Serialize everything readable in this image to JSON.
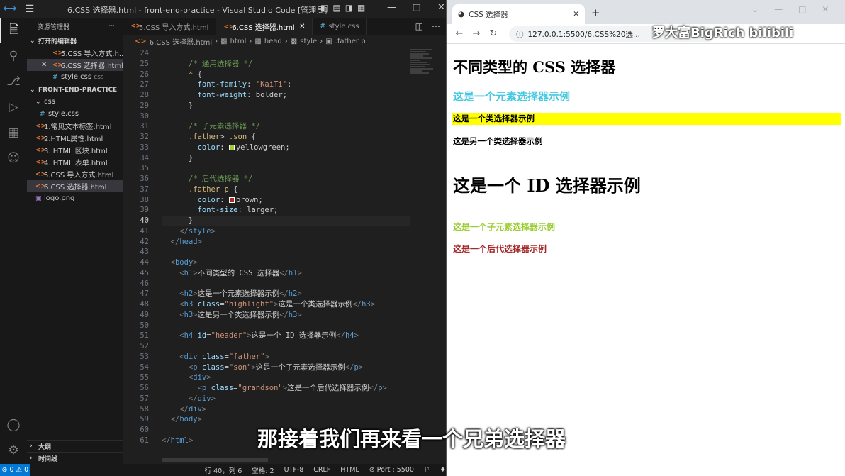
{
  "vscode": {
    "title": "6.CSS 选择器.html - front-end-practice - Visual Studio Code [管理员]",
    "logo": "VS Code logo",
    "window_controls": [
      "—",
      "□",
      "✕"
    ],
    "sidebar": {
      "header": "资源管理器",
      "header_more": "···",
      "open_editors_label": "打开的编辑器",
      "open_editors": [
        {
          "label": "5.CSS 导入方式.h...",
          "type": "html"
        },
        {
          "label": "6.CSS 选择器.html",
          "type": "html",
          "selected": true,
          "close": "✕"
        },
        {
          "label": "style.css",
          "type": "css",
          "suffix": "css"
        }
      ],
      "project_label": "FRONT-END-PRACTICE",
      "folder": "css",
      "folder_files": [
        {
          "label": "style.css",
          "type": "css"
        }
      ],
      "files": [
        {
          "label": "1.常见文本标签.html",
          "type": "html"
        },
        {
          "label": "2.HTML属性.html",
          "type": "html"
        },
        {
          "label": "3. HTML 区块.html",
          "type": "html"
        },
        {
          "label": "4. HTML 表单.html",
          "type": "html"
        },
        {
          "label": "5.CSS 导入方式.html",
          "type": "html"
        },
        {
          "label": "6.CSS 选择器.html",
          "type": "html",
          "selected": true
        },
        {
          "label": "logo.png",
          "type": "img"
        }
      ],
      "outline_label": "大纲",
      "timeline_label": "时间线"
    },
    "tabs": [
      {
        "label": "5.CSS 导入方式.html",
        "active": false
      },
      {
        "label": "6.CSS 选择器.html",
        "active": true,
        "close": "✕"
      },
      {
        "label": "style.css",
        "active": false
      }
    ],
    "breadcrumb": [
      "6.CSS 选择器.html",
      "html",
      "head",
      "style",
      ".father p"
    ],
    "statusbar": {
      "errors": "⊗ 0 ⚠ 0",
      "position": "行 40，列 6",
      "spaces": "空格: 2",
      "encoding": "UTF-8",
      "eol": "CRLF",
      "language": "HTML",
      "port": "⊘ Port : 5500"
    }
  },
  "browser": {
    "tab_title": "CSS 选择器",
    "tab_close": "✕",
    "new_tab": "+",
    "url": "127.0.0.1:5500/6.CSS%20选...",
    "watermark": "罗大富BigRich  bilibili",
    "page": {
      "h1": "不同类型的 CSS 选择器",
      "h2": "这是一个元素选择器示例",
      "h3_highlight": "这是一个类选择器示例",
      "h3_other": "这是另一个类选择器示例",
      "h4": "这是一个 ID 选择器示例",
      "p_son": "这是一个子元素选择器示例",
      "p_grandson": "这是一个后代选择器示例"
    }
  },
  "subtitle": "那接着我们再来看一个兄弟选择器",
  "colors": {
    "accent": "#0078d4",
    "highlight": "#ffff00",
    "yellowgreen": "#9acd32",
    "brown": "#a52a2a"
  }
}
